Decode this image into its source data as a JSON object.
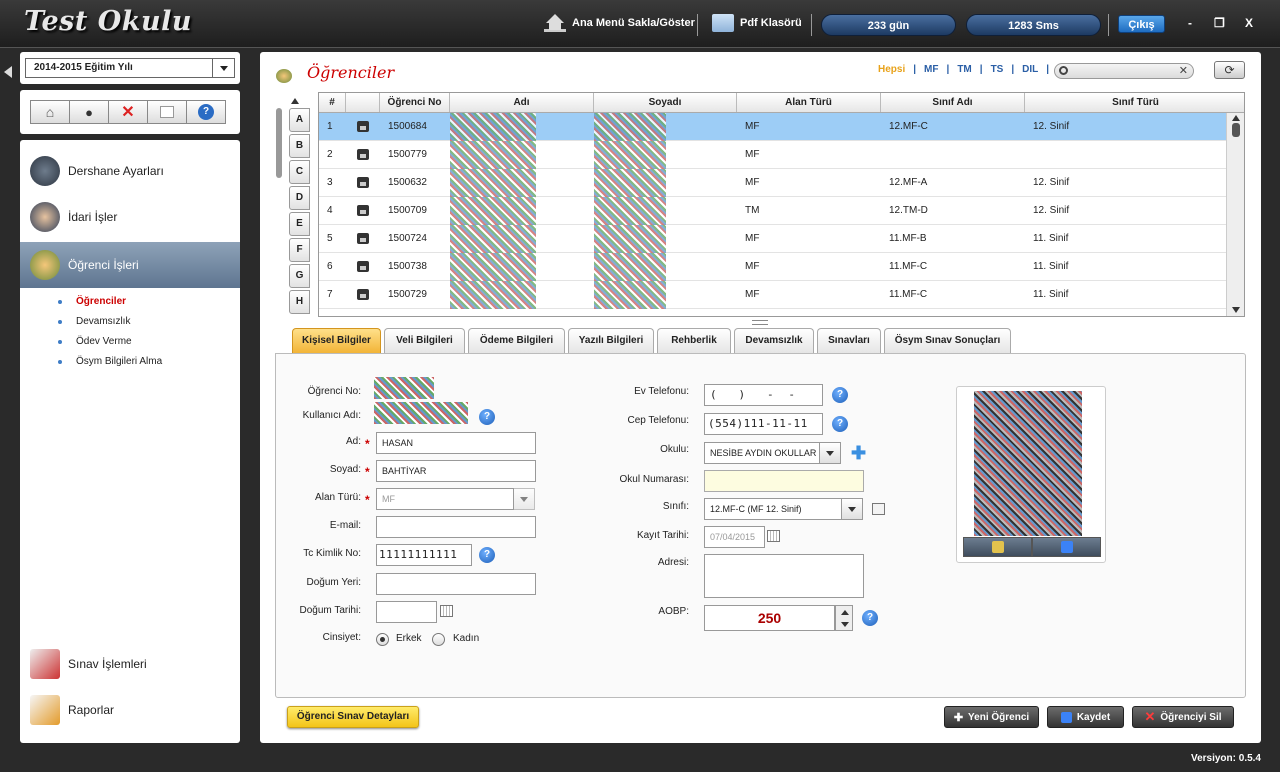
{
  "app": {
    "title": "Test Okulu",
    "version": "Versiyon: 0.5.4"
  },
  "topbar": {
    "toggle_menu": "Ana Menü Sakla/Göster",
    "pdf_folder": "Pdf Klasörü",
    "days": "233 gün",
    "sms": "1283 Sms",
    "exit": "Çıkış",
    "minimize": "-",
    "restore": "❐",
    "close": "X"
  },
  "sidebar": {
    "year": "2014-2015 Eğitim Yılı",
    "items": [
      {
        "label": "Dershane Ayarları"
      },
      {
        "label": "İdari İşler"
      },
      {
        "label": "Öğrenci İşleri"
      }
    ],
    "sub_items": [
      {
        "label": "Öğrenciler"
      },
      {
        "label": "Devamsızlık"
      },
      {
        "label": "Ödev Verme"
      },
      {
        "label": "Ösym Bilgileri Alma"
      }
    ],
    "bottom_items": [
      {
        "label": "Sınav İşlemleri"
      },
      {
        "label": "Raporlar"
      }
    ]
  },
  "main": {
    "title": "Öğrenciler",
    "filters": [
      "Hepsi",
      "MF",
      "TM",
      "TS",
      "DIL"
    ],
    "alphabet": [
      "A",
      "B",
      "C",
      "D",
      "E",
      "F",
      "G",
      "H"
    ],
    "columns": [
      "#",
      "",
      "Öğrenci No",
      "Adı",
      "Soyadı",
      "Alan Türü",
      "Sınıf Adı",
      "Sınıf Türü"
    ],
    "rows": [
      {
        "n": "1",
        "no": "1500684",
        "alan": "MF",
        "sinif": "12.MF-C",
        "tur": "12. Sinif"
      },
      {
        "n": "2",
        "no": "1500779",
        "alan": "MF",
        "sinif": "",
        "tur": ""
      },
      {
        "n": "3",
        "no": "1500632",
        "alan": "MF",
        "sinif": "12.MF-A",
        "tur": "12. Sinif"
      },
      {
        "n": "4",
        "no": "1500709",
        "alan": "TM",
        "sinif": "12.TM-D",
        "tur": "12. Sinif"
      },
      {
        "n": "5",
        "no": "1500724",
        "alan": "MF",
        "sinif": "11.MF-B",
        "tur": "11. Sinif"
      },
      {
        "n": "6",
        "no": "1500738",
        "alan": "MF",
        "sinif": "11.MF-C",
        "tur": "11. Sinif"
      },
      {
        "n": "7",
        "no": "1500729",
        "alan": "MF",
        "sinif": "11.MF-C",
        "tur": "11. Sinif"
      }
    ],
    "tabs": [
      "Kişisel Bilgiler",
      "Veli Bilgileri",
      "Ödeme Bilgileri",
      "Yazılı Bilgileri",
      "Rehberlik",
      "Devamsızlık",
      "Sınavları",
      "Ösym Sınav Sonuçları"
    ]
  },
  "form": {
    "labels": {
      "student_no": "Öğrenci No:",
      "username": "Kullanıcı Adı:",
      "name": "Ad:",
      "surname": "Soyad:",
      "field": "Alan Türü:",
      "email": "E-mail:",
      "tc": "Tc Kimlik No:",
      "birth_place": "Doğum Yeri:",
      "birth_date": "Doğum Tarihi:",
      "gender": "Cinsiyet:",
      "male": "Erkek",
      "female": "Kadın",
      "home_phone": "Ev Telefonu:",
      "mobile": "Cep Telefonu:",
      "school": "Okulu:",
      "school_no": "Okul Numarası:",
      "class": "Sınıfı:",
      "reg_date": "Kayıt Tarihi:",
      "address": "Adresi:",
      "aobp": "AOBP:"
    },
    "values": {
      "name": "HASAN",
      "surname": "BAHTİYAR",
      "field": "MF",
      "tc": "11111111111",
      "home_phone": "(   )   -  -  ",
      "mobile": "(554)111-11-11",
      "school": "NESİBE AYDIN OKULLAR",
      "class": "12.MF-C (MF 12. Sinif)",
      "reg_date": "07/04/2015",
      "aobp": "250"
    }
  },
  "actions": {
    "exam_details": "Öğrenci Sınav Detayları",
    "new_student": "Yeni Öğrenci",
    "save": "Kaydet",
    "delete": "Öğrenciyi Sil"
  }
}
